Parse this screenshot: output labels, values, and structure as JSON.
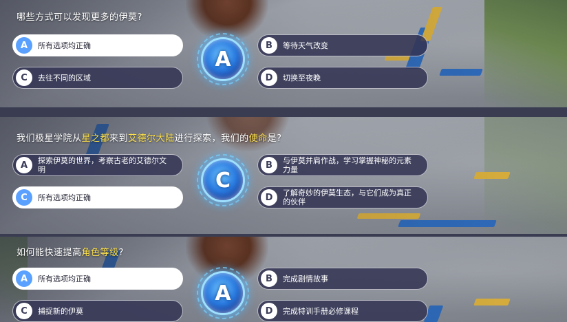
{
  "panels": [
    {
      "question_parts": [
        {
          "text": "哪些方式可以发现更多的伊莫?",
          "highlight": false
        }
      ],
      "options": [
        {
          "letter": "A",
          "text": "所有选项均正确",
          "selected": true
        },
        {
          "letter": "B",
          "text": "等待天气改变",
          "selected": false
        },
        {
          "letter": "C",
          "text": "去往不同的区域",
          "selected": false
        },
        {
          "letter": "D",
          "text": "切换至夜晚",
          "selected": false
        }
      ],
      "answer": "A"
    },
    {
      "question_parts": [
        {
          "text": "我们极星学院从",
          "highlight": false
        },
        {
          "text": "星之都",
          "highlight": true
        },
        {
          "text": "来到",
          "highlight": false
        },
        {
          "text": "艾德尔大陆",
          "highlight": true
        },
        {
          "text": "进行探索，我们的",
          "highlight": false
        },
        {
          "text": "使命",
          "highlight": true
        },
        {
          "text": "是?",
          "highlight": false
        }
      ],
      "options": [
        {
          "letter": "A",
          "text": "探索伊莫的世界，考察古老的艾德尔文明",
          "selected": false
        },
        {
          "letter": "B",
          "text": "与伊莫并肩作战，学习掌握神秘的元素力量",
          "selected": false
        },
        {
          "letter": "C",
          "text": "所有选项均正确",
          "selected": true
        },
        {
          "letter": "D",
          "text": "了解奇妙的伊莫生态，与它们成为真正的伙伴",
          "selected": false
        }
      ],
      "answer": "C"
    },
    {
      "question_parts": [
        {
          "text": "如何能快速提高",
          "highlight": false
        },
        {
          "text": "角色等级",
          "highlight": true
        },
        {
          "text": "?",
          "highlight": false
        }
      ],
      "options": [
        {
          "letter": "A",
          "text": "所有选项均正确",
          "selected": true
        },
        {
          "letter": "B",
          "text": "完成剧情故事",
          "selected": false
        },
        {
          "letter": "C",
          "text": "捕捉新的伊莫",
          "selected": false
        },
        {
          "letter": "D",
          "text": "完成特训手册必修课程",
          "selected": false
        }
      ],
      "answer": "A"
    }
  ],
  "colors": {
    "highlight": "#ffe24a",
    "selected_letter": "#5aa0ff",
    "option_bg": "#343654",
    "badge_glow": "#50b4ff"
  }
}
